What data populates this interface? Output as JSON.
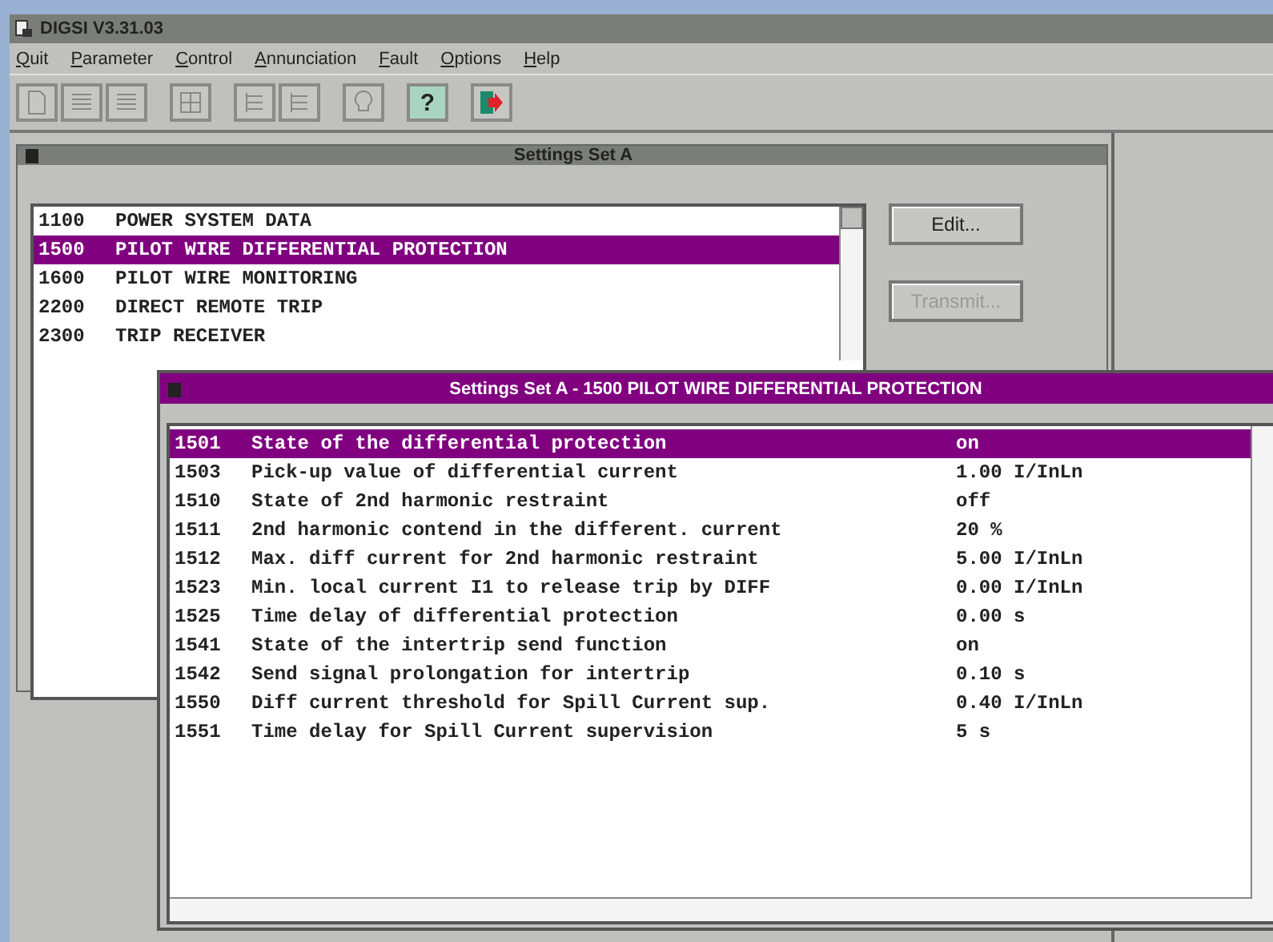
{
  "app": {
    "title": "DIGSI V3.31.03",
    "menu": [
      "Quit",
      "Parameter",
      "Control",
      "Annunciation",
      "Fault",
      "Options",
      "Help"
    ],
    "toolbar": [
      [
        {
          "kind": "page"
        },
        {
          "kind": "list"
        },
        {
          "kind": "list"
        }
      ],
      [
        {
          "kind": "grid"
        }
      ],
      [
        {
          "kind": "tree"
        },
        {
          "kind": "tree"
        }
      ],
      [
        {
          "kind": "bulb"
        }
      ],
      [
        {
          "kind": "help",
          "label": "?"
        }
      ],
      [
        {
          "kind": "exit"
        }
      ]
    ]
  },
  "settings_window": {
    "title": "Settings Set A",
    "items": [
      {
        "code": "1100",
        "label": "POWER SYSTEM DATA",
        "selected": false
      },
      {
        "code": "1500",
        "label": "PILOT WIRE DIFFERENTIAL PROTECTION",
        "selected": true
      },
      {
        "code": "1600",
        "label": "PILOT WIRE MONITORING",
        "selected": false
      },
      {
        "code": "2200",
        "label": "DIRECT REMOTE TRIP",
        "selected": false
      },
      {
        "code": "2300",
        "label": "TRIP RECEIVER",
        "selected": false
      }
    ],
    "buttons": [
      {
        "label": "Edit...",
        "disabled": false
      },
      {
        "label": "Transmit...",
        "disabled": true
      }
    ]
  },
  "detail_window": {
    "title": "Settings Set A - 1500  PILOT WIRE DIFFERENTIAL PROTECTION",
    "rows": [
      {
        "code": "1501",
        "label": "State of the differential protection",
        "value": "on",
        "selected": true
      },
      {
        "code": "1503",
        "label": "Pick-up value of differential current",
        "value": "1.00 I/InLn",
        "selected": false
      },
      {
        "code": "1510",
        "label": "State of 2nd harmonic restraint",
        "value": "off",
        "selected": false
      },
      {
        "code": "1511",
        "label": "2nd harmonic contend in the different. current",
        "value": "20 %",
        "selected": false
      },
      {
        "code": "1512",
        "label": "Max. diff current for 2nd harmonic restraint",
        "value": "5.00 I/InLn",
        "selected": false
      },
      {
        "code": "1523",
        "label": "Min. local current I1 to release trip by DIFF",
        "value": "0.00 I/InLn",
        "selected": false
      },
      {
        "code": "1525",
        "label": "Time delay of differential protection",
        "value": "0.00 s",
        "selected": false
      },
      {
        "code": "1541",
        "label": "State of the intertrip send function",
        "value": "on",
        "selected": false
      },
      {
        "code": "1542",
        "label": "Send signal prolongation for intertrip",
        "value": "0.10 s",
        "selected": false
      },
      {
        "code": "1550",
        "label": "Diff current threshold for Spill Current sup.",
        "value": "0.40 I/InLn",
        "selected": false
      },
      {
        "code": "1551",
        "label": "Time delay for Spill Current supervision",
        "value": "5 s",
        "selected": false
      }
    ]
  }
}
